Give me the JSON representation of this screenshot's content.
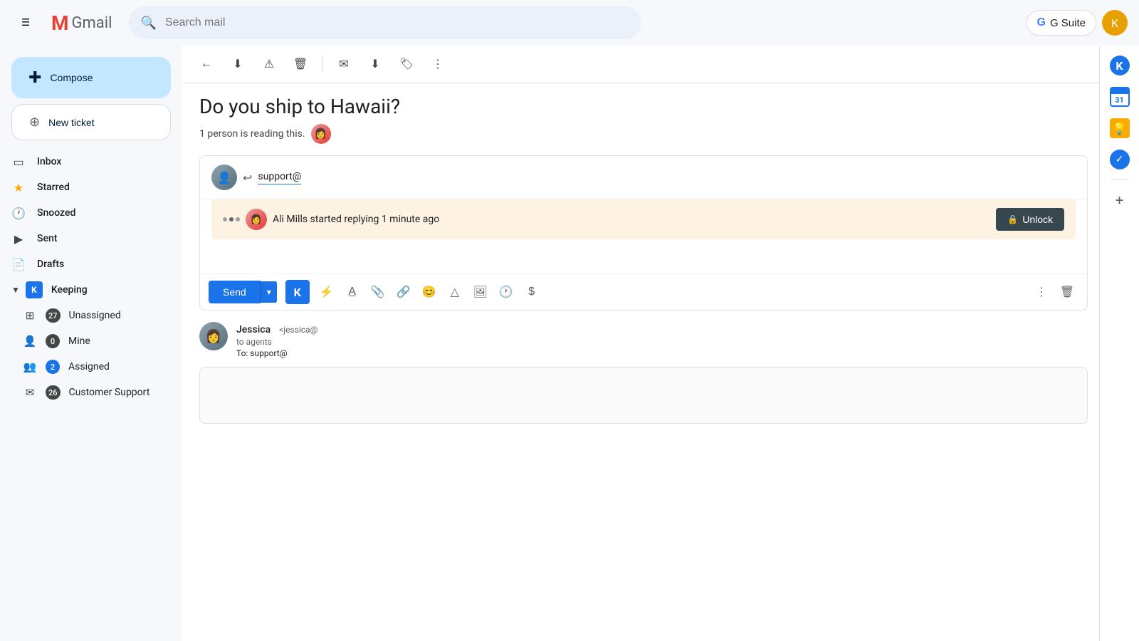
{
  "topbar": {
    "hamburger_label": "☰",
    "gmail_m_color": "#EA4335",
    "gmail_label": "Gmail",
    "search_placeholder": "Search mail",
    "gsuite_label": "G Suite",
    "avatar_initial": "K"
  },
  "sidebar": {
    "compose_label": "Compose",
    "new_ticket_label": "New ticket",
    "nav_items": [
      {
        "id": "inbox",
        "icon": "▭",
        "label": "Inbox",
        "count": ""
      },
      {
        "id": "starred",
        "icon": "★",
        "label": "Starred",
        "count": ""
      },
      {
        "id": "snoozed",
        "icon": "🕐",
        "label": "Snoozed",
        "count": ""
      },
      {
        "id": "sent",
        "icon": "▶",
        "label": "Sent",
        "count": ""
      },
      {
        "id": "drafts",
        "icon": "📄",
        "label": "Drafts",
        "count": ""
      }
    ],
    "keeping_label": "Keeping",
    "sub_items": [
      {
        "id": "unassigned",
        "icon": "⊞",
        "label": "Unassigned",
        "count": "27"
      },
      {
        "id": "mine",
        "icon": "👤",
        "label": "Mine",
        "count": "0"
      },
      {
        "id": "assigned",
        "icon": "👥",
        "label": "Assigned",
        "count": "2"
      },
      {
        "id": "customer-support",
        "icon": "✉",
        "label": "Customer Support",
        "count": "26"
      }
    ]
  },
  "toolbar": {
    "back_title": "Back",
    "archive_title": "Archive",
    "report_title": "Report spam",
    "delete_title": "Delete",
    "mark_title": "Mark as read",
    "move_title": "Move to",
    "label_title": "Label as",
    "more_title": "More"
  },
  "email": {
    "subject": "Do you ship to Hawaii?",
    "reading_text": "1 person is reading this.",
    "reply_to": "support@",
    "unlock_banner": {
      "text": "Ali Mills started replying 1 minute ago",
      "btn_label": "Unlock"
    },
    "send_label": "Send",
    "message": {
      "sender_name": "Jessica",
      "sender_email": "<jessica@",
      "to_label": "to agents",
      "to_address": "To: support@"
    }
  },
  "right_panel": {
    "calendar_date": "31",
    "lightbulb_title": "Insights",
    "check_title": "Tasks",
    "plus_title": "Add"
  }
}
